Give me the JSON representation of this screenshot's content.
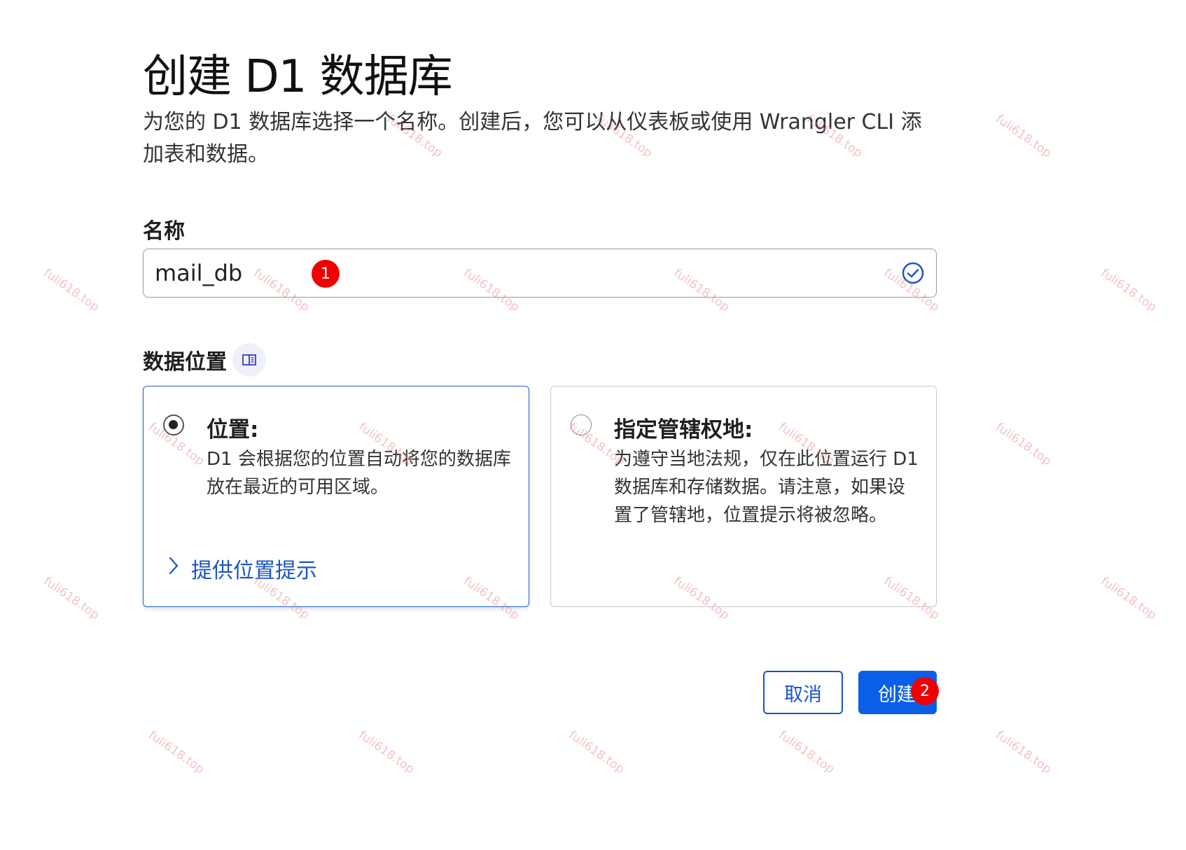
{
  "title": "创建 D1 数据库",
  "description": "为您的 D1 数据库选择一个名称。创建后，您可以从仪表板或使用 Wrangler CLI 添加表和数据。",
  "name_field": {
    "label": "名称",
    "value": "mail_db",
    "badge": "1"
  },
  "location": {
    "label": "数据位置",
    "options": [
      {
        "title": "位置:",
        "body": "D1 会根据您的位置自动将您的数据库放在最近的可用区域。",
        "link": "提供位置提示",
        "selected": true
      },
      {
        "title": "指定管辖权地:",
        "body": "为遵守当地法规，仅在此位置运行 D1 数据库和存储数据。请注意，如果设置了管辖地，位置提示将被忽略。",
        "selected": false
      }
    ]
  },
  "buttons": {
    "cancel": "取消",
    "create": "创建",
    "create_badge": "2"
  },
  "watermark": "fuli618.top",
  "colors": {
    "primary": "#0b5ee8",
    "link": "#1a55c7",
    "badge": "#f00000"
  }
}
